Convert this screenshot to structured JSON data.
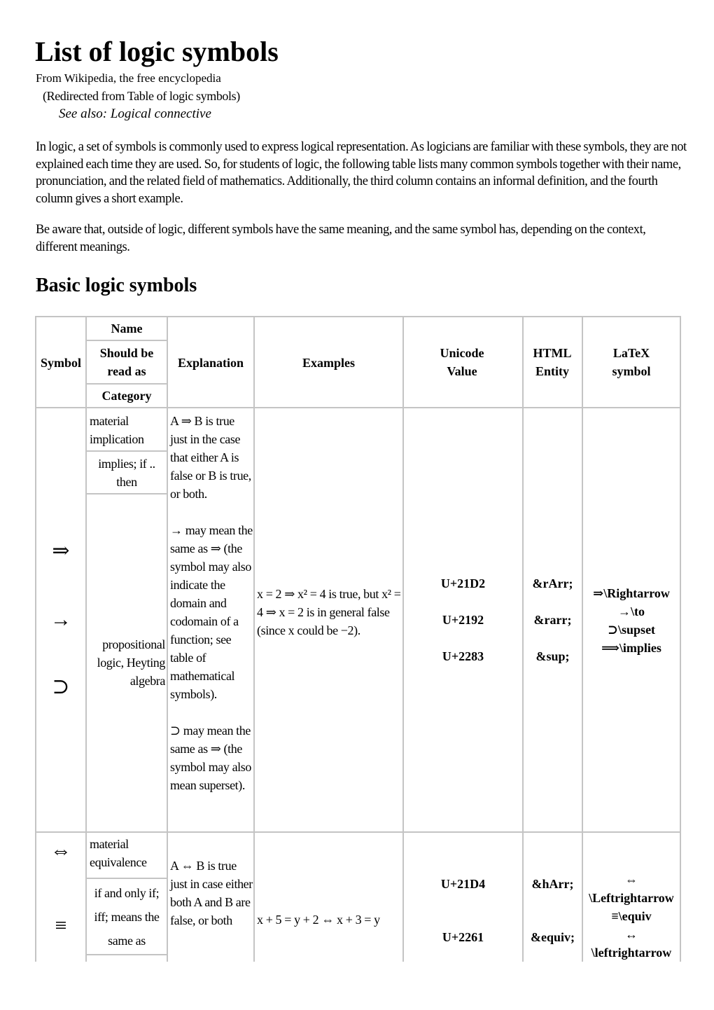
{
  "page": {
    "title": "List of logic symbols",
    "tagline": "From Wikipedia, the free encyclopedia",
    "redirect": "(Redirected from Table of logic symbols)",
    "see_also": "See also: Logical connective",
    "paragraphs": [
      "In logic, a set of symbols is commonly used to express logical representation. As logicians are familiar with these symbols, they are not explained each time they are used. So, for students of logic, the following table lists many common symbols together with their name, pronunciation, and the related field of mathematics. Additionally, the third column contains an informal definition, and the fourth column gives a short example.",
      "Be aware that, outside of logic, different symbols have the same meaning, and the same symbol has, depending on the context, different meanings."
    ],
    "section_title": "Basic logic symbols"
  },
  "table": {
    "headers": {
      "symbol": "Symbol",
      "name": "Name",
      "read_as": "Should be read as",
      "category": "Category",
      "explanation": "Explanation",
      "examples": "Examples",
      "unicode": "Unicode Value",
      "html": "HTML Entity",
      "latex": "LaTeX symbol"
    },
    "rows": [
      {
        "symbols": [
          "⇒",
          "→",
          "⊃"
        ],
        "name": "material implication",
        "read_as": "implies; if .. then",
        "category": "propositional logic, Heyting algebra",
        "explanation": [
          "A ⇒ B is true just in the case that either A is false or B is true, or both.",
          "→ may mean the same as ⇒ (the symbol may also indicate the domain and codomain of a function; see table of mathematical symbols).",
          "⊃ may mean the same as ⇒ (the symbol may also mean superset)."
        ],
        "example": "x = 2 ⇒ x² = 4 is true, but x² = 4 ⇒ x = 2 is in general false (since x could be −2).",
        "unicode": [
          "U+21D2",
          "U+2192",
          "U+2283"
        ],
        "html": [
          "&rArr;",
          "&rarr;",
          "&sup;"
        ],
        "latex": [
          {
            "glyph": "⇒",
            "command": "\\Rightarrow"
          },
          {
            "glyph": "→",
            "command": "\\to"
          },
          {
            "glyph": "⊃",
            "command": "\\supset"
          },
          {
            "glyph": "⟹",
            "command": "\\implies"
          }
        ]
      },
      {
        "symbols": [
          "⇔",
          "≡"
        ],
        "name": "material equivalence",
        "read_as": "if and only if; iff; means the same as",
        "category": "",
        "explanation": [
          "A ⇔ B is true just in case either both A and B are false, or both"
        ],
        "example": "x + 5 = y + 2 ⇔ x + 3 = y",
        "unicode": [
          "U+21D4",
          "U+2261"
        ],
        "html": [
          "&hArr;",
          "&equiv;"
        ],
        "latex": [
          {
            "glyph": "⇔",
            "command": "\\Leftrightarrow"
          },
          {
            "glyph": "≡",
            "command": "\\equiv"
          },
          {
            "glyph": "↔",
            "command": "\\leftrightarrow"
          }
        ]
      }
    ]
  }
}
